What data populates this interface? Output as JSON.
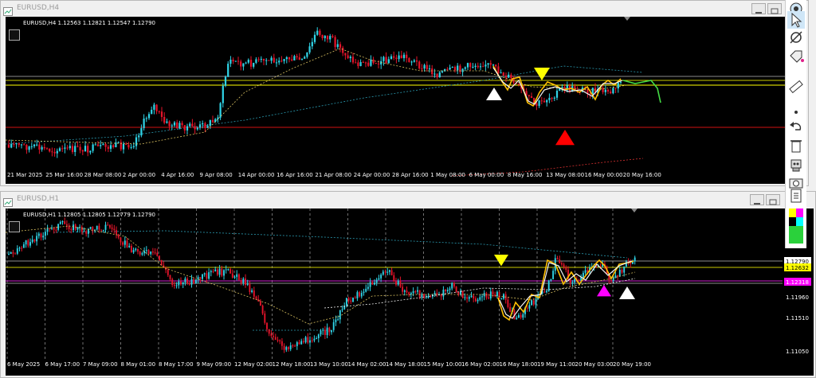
{
  "windows": [
    {
      "title": "EURUSD,H4",
      "ohlc": "EURUSD,H4  1.12563 1.12821 1.12547 1.12790",
      "time_labels": [
        "21 Mar 2025",
        "25 Mar 16:00",
        "28 Mar 08:00",
        "2 Apr 00:00",
        "4 Apr 16:00",
        "9 Apr 08:00",
        "14 Apr 00:00",
        "16 Apr 16:00",
        "21 Apr 08:00",
        "24 Apr 00:00",
        "28 Apr 16:00",
        "1 May 08:00",
        "6 May 00:00",
        "8 May 16:00",
        "13 May 08:00",
        "16 May 00:00",
        "20 May 16:00"
      ],
      "price_labels": []
    },
    {
      "title": "EURUSD,H1",
      "ohlc": "EURUSD,H1  1.12805 1.12805 1.12779 1.12790",
      "time_labels": [
        "6 May 2025",
        "6 May 17:00",
        "7 May 09:00",
        "8 May 01:00",
        "8 May 17:00",
        "9 May 09:00",
        "12 May 02:00",
        "12 May 18:00",
        "13 May 10:00",
        "14 May 02:00",
        "14 May 18:00",
        "15 May 10:00",
        "16 May 02:00",
        "16 May 18:00",
        "19 May 11:00",
        "20 May 03:00",
        "20 May 19:00"
      ],
      "price_labels": [
        "1.12790",
        "1.12632",
        "1.12318",
        "1.11960",
        "1.11510",
        "1.11050"
      ]
    }
  ],
  "colors": {
    "bull": "#2fd3e6",
    "bear": "#e3142a",
    "yellow_line": "#c8c800",
    "red_line": "#d01010",
    "magenta_line": "#d020d0",
    "zigzag": "#ffc000",
    "forecast": "#44dd44",
    "ma": "#d8c060",
    "ma_long": "#2a9ab0"
  },
  "toolbar_icons": [
    "eye-icon",
    "cursor-icon",
    "crosshair-icon",
    "tag-icon",
    "ruler-icon",
    "dot-icon",
    "undo-icon",
    "trash-icon",
    "robot-icon",
    "camera-icon",
    "clipboard-icon",
    "color-palette-icon",
    "color-green-icon"
  ]
}
